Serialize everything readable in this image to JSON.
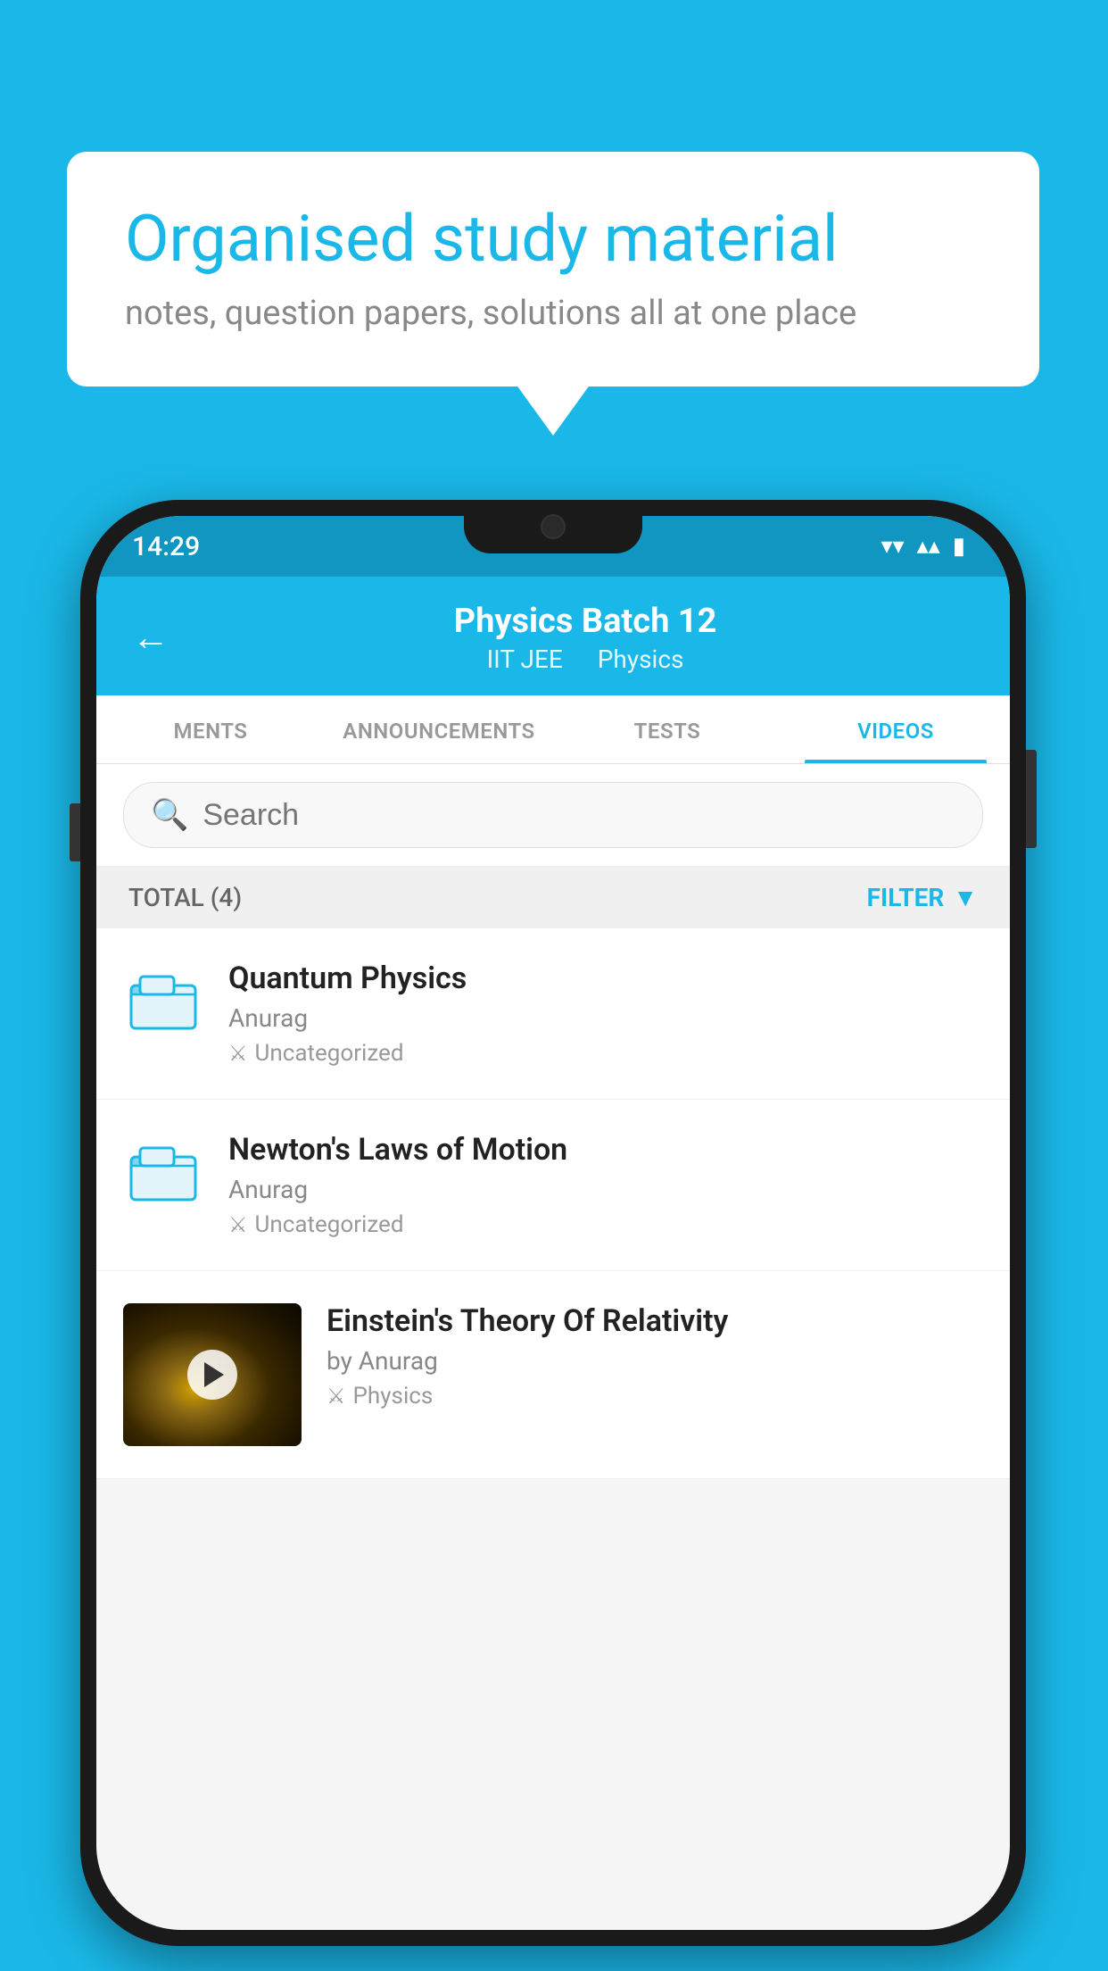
{
  "background_color": "#1ab8e8",
  "speech_bubble": {
    "title": "Organised study material",
    "subtitle": "notes, question papers, solutions all at one place"
  },
  "status_bar": {
    "time": "14:29",
    "wifi": "▼",
    "signal": "▲",
    "battery": "▮"
  },
  "header": {
    "title": "Physics Batch 12",
    "tag1": "IIT JEE",
    "tag2": "Physics",
    "back_label": "←"
  },
  "tabs": [
    {
      "label": "MENTS",
      "active": false
    },
    {
      "label": "ANNOUNCEMENTS",
      "active": false
    },
    {
      "label": "TESTS",
      "active": false
    },
    {
      "label": "VIDEOS",
      "active": true
    }
  ],
  "search": {
    "placeholder": "Search"
  },
  "filter_bar": {
    "total_label": "TOTAL (4)",
    "filter_label": "FILTER"
  },
  "videos": [
    {
      "title": "Quantum Physics",
      "author": "Anurag",
      "tag": "Uncategorized",
      "has_thumb": false
    },
    {
      "title": "Newton's Laws of Motion",
      "author": "Anurag",
      "tag": "Uncategorized",
      "has_thumb": false
    },
    {
      "title": "Einstein's Theory Of Relativity",
      "author": "by Anurag",
      "tag": "Physics",
      "has_thumb": true
    }
  ]
}
